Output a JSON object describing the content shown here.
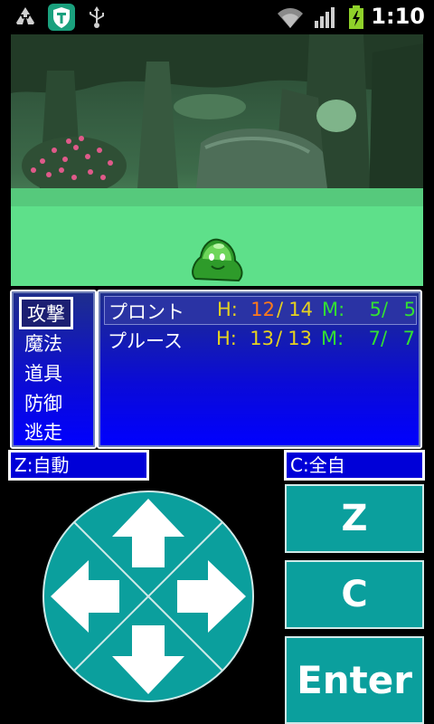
{
  "status_bar": {
    "time": "1:10",
    "icons": [
      "recycle-icon",
      "shield-t-icon",
      "usb-icon",
      "wifi-icon",
      "signal-icon",
      "battery-charging-icon"
    ]
  },
  "scene": {
    "enemy": "green-slime"
  },
  "commands": {
    "items": [
      "攻撃",
      "魔法",
      "道具",
      "防御",
      "逃走"
    ],
    "selected_index": 0
  },
  "party": [
    {
      "name": "プロント",
      "hp_label": "H:",
      "hp": "12",
      "hp_max": "14",
      "mp_label": "M:",
      "mp": "5",
      "mp_max": "5"
    },
    {
      "name": "プルース",
      "hp_label": "H:",
      "hp": "13",
      "hp_max": "13",
      "mp_label": "M:",
      "mp": "7",
      "mp_max": "7"
    }
  ],
  "modes": {
    "z_label": "Z:自動",
    "c_label": "C:全自"
  },
  "buttons": {
    "z": "Z",
    "c": "C",
    "enter": "Enter"
  },
  "colors": {
    "panel_blue": "#0000ff",
    "teal": "#0b9f9d",
    "ground_green": "#5ee08a"
  }
}
